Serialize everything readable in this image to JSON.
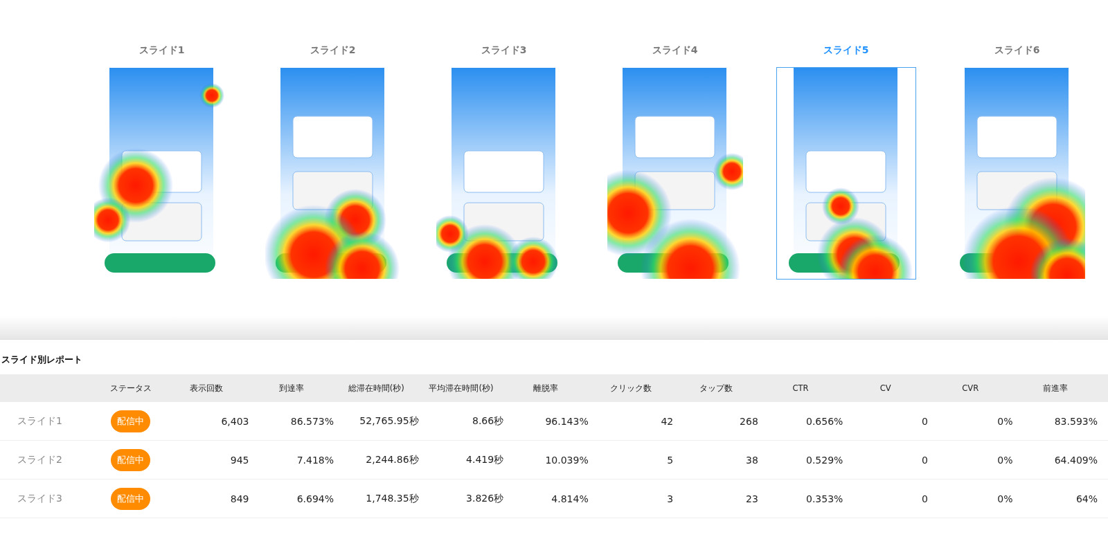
{
  "slides": [
    {
      "label": "スライド1",
      "selected": false,
      "kind": "picture"
    },
    {
      "label": "スライド2",
      "selected": false,
      "kind": "picture"
    },
    {
      "label": "スライド3",
      "selected": false,
      "kind": "picture"
    },
    {
      "label": "スライド4",
      "selected": false,
      "kind": "picture"
    },
    {
      "label": "スライド5",
      "selected": true,
      "kind": "picture"
    },
    {
      "label": "スライド6",
      "selected": false,
      "kind": "picture"
    }
  ],
  "report": {
    "title": "スライド別レポート",
    "columns": [
      "",
      "ステータス",
      "表示回数",
      "到達率",
      "総滞在時間(秒)",
      "平均滞在時間(秒)",
      "離脱率",
      "クリック数",
      "タップ数",
      "CTR",
      "CV",
      "CVR",
      "前進率"
    ],
    "rows": [
      {
        "cells": [
          "スライド1",
          "配信中",
          "6,403",
          "86.573%",
          "52,765.95秒",
          "8.66秒",
          "96.143%",
          "42",
          "268",
          "0.656%",
          "0",
          "0%",
          "83.593%"
        ]
      },
      {
        "cells": [
          "スライド2",
          "配信中",
          "945",
          "7.418%",
          "2,244.86秒",
          "4.419秒",
          "10.039%",
          "5",
          "38",
          "0.529%",
          "0",
          "0%",
          "64.409%"
        ]
      },
      {
        "cells": [
          "スライド3",
          "配信中",
          "849",
          "6.694%",
          "1,748.35秒",
          "3.826秒",
          "4.814%",
          "3",
          "23",
          "0.353%",
          "0",
          "0%",
          "64%"
        ]
      }
    ]
  }
}
